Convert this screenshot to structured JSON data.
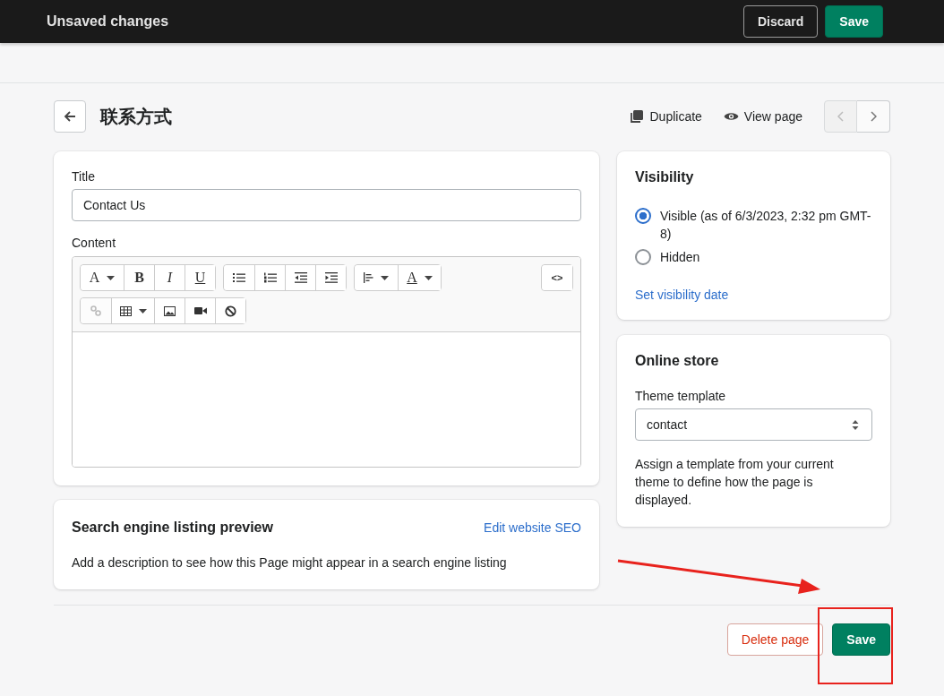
{
  "top_bar": {
    "title": "Unsaved changes",
    "buttons": [
      {
        "kind": "secondary",
        "label": "Discard"
      },
      {
        "kind": "primary",
        "label": "Save"
      }
    ]
  },
  "header": {
    "title": "联系方式",
    "actions": [
      {
        "kind": "duplicate",
        "label": "Duplicate"
      },
      {
        "kind": "view",
        "label": "View page"
      }
    ],
    "pager": [
      {
        "kind": "prev",
        "disabled": true
      },
      {
        "kind": "next",
        "disabled": false
      }
    ]
  },
  "page_card": {
    "title_label": "Title",
    "title_value": "Contact Us",
    "content_label": "Content",
    "toolbar": [
      [
        {
          "kind": "font",
          "label": "A",
          "dropdown": true
        },
        {
          "kind": "bold",
          "label": "B"
        },
        {
          "kind": "italic",
          "label": "I"
        },
        {
          "kind": "underline",
          "label": "U"
        }
      ],
      [
        {
          "kind": "bullet-list"
        },
        {
          "kind": "numbered-list"
        },
        {
          "kind": "outdent"
        },
        {
          "kind": "indent"
        }
      ],
      [
        {
          "kind": "align",
          "dropdown": true
        },
        {
          "kind": "text-color",
          "label": "A",
          "dropdown": true
        }
      ],
      [
        {
          "kind": "code",
          "label": "<>"
        }
      ],
      [
        {
          "kind": "link",
          "disabled": true
        },
        {
          "kind": "table",
          "dropdown": true
        },
        {
          "kind": "image"
        },
        {
          "kind": "video"
        },
        {
          "kind": "clear"
        }
      ]
    ]
  },
  "seo_card": {
    "title": "Search engine listing preview",
    "link": "Edit website SEO",
    "description": "Add a description to see how this Page might appear in a search engine listing"
  },
  "visibility_card": {
    "title": "Visibility",
    "options": [
      {
        "label": "Visible (as of 6/3/2023, 2:32 pm GMT-8)",
        "selected": true
      },
      {
        "label": "Hidden",
        "selected": false
      }
    ],
    "link": "Set visibility date"
  },
  "online_store_card": {
    "title": "Online store",
    "template_label": "Theme template",
    "template_value": "contact",
    "help": "Assign a template from your current theme to define how the page is displayed."
  },
  "footer": {
    "buttons": [
      {
        "kind": "destructive",
        "label": "Delete page"
      },
      {
        "kind": "primary",
        "label": "Save"
      }
    ]
  }
}
